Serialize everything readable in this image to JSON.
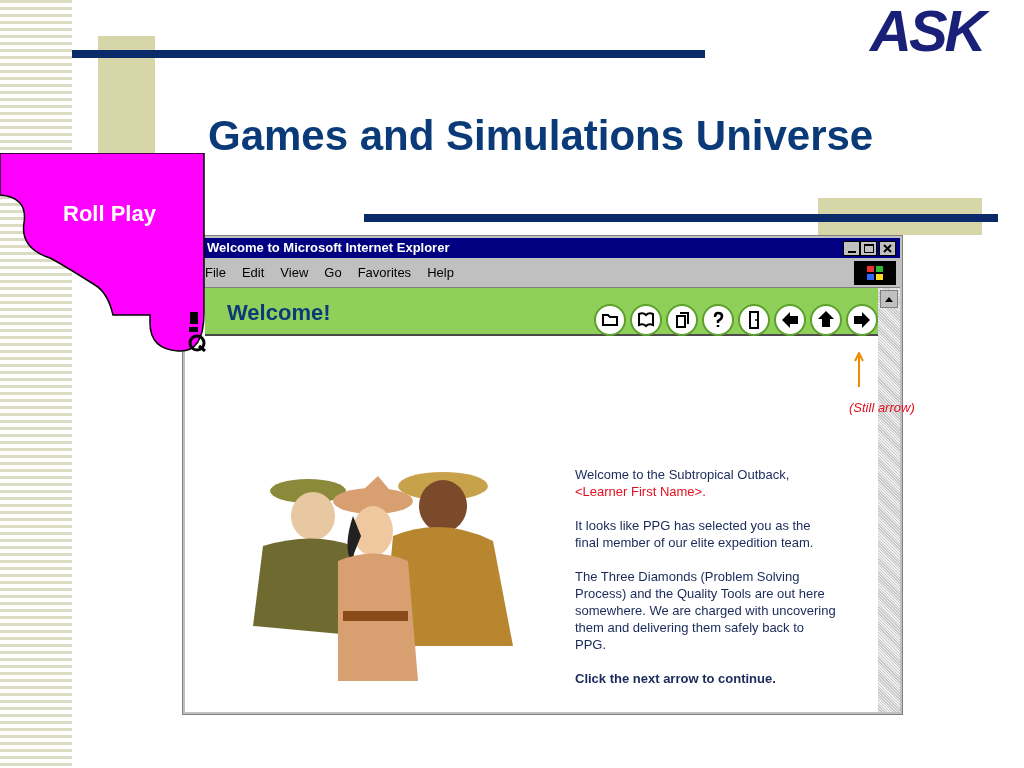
{
  "logo": {
    "text": "ASK"
  },
  "slide_title": "Games and Simulations Universe",
  "callout": {
    "label": "Roll Play"
  },
  "window": {
    "title": "Welcome to Microsoft Internet Explorer",
    "menu": [
      "File",
      "Edit",
      "View",
      "Go",
      "Favorites",
      "Help"
    ]
  },
  "page": {
    "heading": "Welcome!",
    "annotation": "(Still arrow)",
    "paragraphs": [
      {
        "kind": "plain",
        "text": "Welcome to the Subtropical Outback,"
      },
      {
        "kind": "variable",
        "text": "<Learner First Name>."
      },
      {
        "kind": "plain",
        "text": "It looks like PPG has selected you as the final member of our elite expedition team."
      },
      {
        "kind": "plain",
        "text": "The Three Diamonds (Problem Solving Process) and the Quality Tools are out here somewhere. We are charged with uncovering them and delivering them safely back to PPG."
      },
      {
        "kind": "bold",
        "text": "Click the next arrow to continue."
      }
    ]
  }
}
